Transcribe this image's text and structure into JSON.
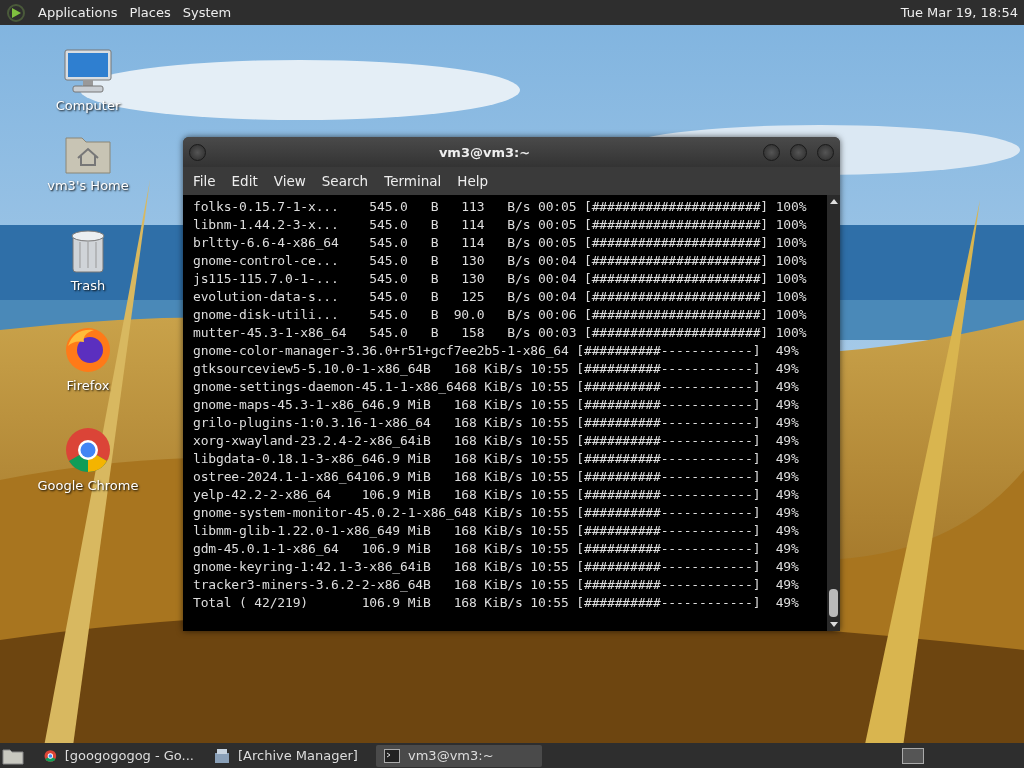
{
  "top_panel": {
    "menus": [
      "Applications",
      "Places",
      "System"
    ],
    "clock": "Tue Mar 19, 18:54"
  },
  "desktop_icons": [
    {
      "kind": "computer",
      "label": "Computer"
    },
    {
      "kind": "home",
      "label": "vm3's Home"
    },
    {
      "kind": "trash",
      "label": "Trash"
    },
    {
      "kind": "firefox",
      "label": "Firefox"
    },
    {
      "kind": "chrome",
      "label": "Google Chrome"
    }
  ],
  "window": {
    "title": "vm3@vm3:~",
    "menu": [
      "File",
      "Edit",
      "View",
      "Search",
      "Terminal",
      "Help"
    ],
    "lines": [
      "folks-0.15.7-1-x...    545.0   B   113   B/s 00:05 [######################] 100%",
      "libnm-1.44.2-3-x...    545.0   B   114   B/s 00:05 [######################] 100%",
      "brltty-6.6-4-x86_64    545.0   B   114   B/s 00:05 [######################] 100%",
      "gnome-control-ce...    545.0   B   130   B/s 00:04 [######################] 100%",
      "js115-115.7.0-1-...    545.0   B   130   B/s 00:04 [######################] 100%",
      "evolution-data-s...    545.0   B   125   B/s 00:04 [######################] 100%",
      "gnome-disk-utili...    545.0   B  90.0   B/s 00:06 [######################] 100%",
      "mutter-45.3-1-x86_64   545.0   B   158   B/s 00:03 [######################] 100%",
      "gnome-color-manager-3.36.0+r51+gcf7ee2b5-1-x86_64 [##########------------]  49%",
      "gtksourceview5-5.10.0-1-x86_64B   168 KiB/s 10:55 [##########------------]  49%",
      "gnome-settings-daemon-45.1-1-x86_6468 KiB/s 10:55 [##########------------]  49%",
      "gnome-maps-45.3-1-x86_646.9 MiB   168 KiB/s 10:55 [##########------------]  49%",
      "grilo-plugins-1:0.3.16-1-x86_64   168 KiB/s 10:55 [##########------------]  49%",
      "xorg-xwayland-23.2.4-2-x86_64iB   168 KiB/s 10:55 [##########------------]  49%",
      "libgdata-0.18.1-3-x86_646.9 MiB   168 KiB/s 10:55 [##########------------]  49%",
      "ostree-2024.1-1-x86_64106.9 MiB   168 KiB/s 10:55 [##########------------]  49%",
      "yelp-42.2-2-x86_64    106.9 MiB   168 KiB/s 10:55 [##########------------]  49%",
      "gnome-system-monitor-45.0.2-1-x86_648 KiB/s 10:55 [##########------------]  49%",
      "libmm-glib-1.22.0-1-x86_649 MiB   168 KiB/s 10:55 [##########------------]  49%",
      "gdm-45.0.1-1-x86_64   106.9 MiB   168 KiB/s 10:55 [##########------------]  49%",
      "gnome-keyring-1:42.1-3-x86_64iB   168 KiB/s 10:55 [##########------------]  49%",
      "tracker3-miners-3.6.2-2-x86_64B   168 KiB/s 10:55 [##########------------]  49%",
      "Total ( 42/219)       106.9 MiB   168 KiB/s 10:55 [##########------------]  49%"
    ]
  },
  "taskbar": [
    {
      "kind": "chrome",
      "label": "[googogogog - Go...",
      "selected": false
    },
    {
      "kind": "archive",
      "label": "[Archive Manager]",
      "selected": false
    },
    {
      "kind": "terminal",
      "label": "vm3@vm3:~",
      "selected": true
    }
  ]
}
